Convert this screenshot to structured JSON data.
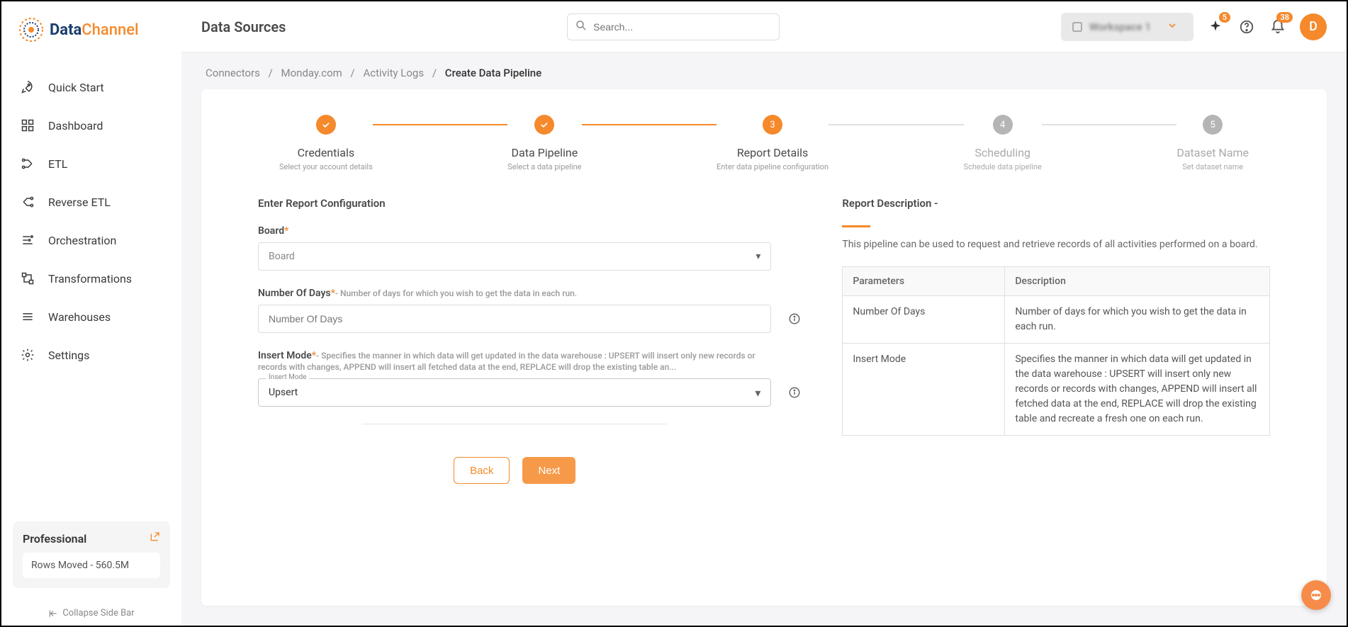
{
  "brand": {
    "part1": "Data",
    "part2": "Channel"
  },
  "header": {
    "title": "Data Sources",
    "search_placeholder": "Search...",
    "workspace": "Workspace 1",
    "sparkle_badge": "5",
    "bell_badge": "38",
    "avatar": "D"
  },
  "sidebar": {
    "items": [
      {
        "label": "Quick Start",
        "icon": "rocket"
      },
      {
        "label": "Dashboard",
        "icon": "grid"
      },
      {
        "label": "ETL",
        "icon": "etl"
      },
      {
        "label": "Reverse ETL",
        "icon": "reverse-etl"
      },
      {
        "label": "Orchestration",
        "icon": "orchestration"
      },
      {
        "label": "Transformations",
        "icon": "transform"
      },
      {
        "label": "Warehouses",
        "icon": "warehouse"
      },
      {
        "label": "Settings",
        "icon": "gear"
      }
    ],
    "plan_title": "Professional",
    "rows_moved": "Rows Moved - 560.5M",
    "collapse": "Collapse Side Bar"
  },
  "breadcrumb": {
    "items": [
      "Connectors",
      "Monday.com",
      "Activity Logs",
      "Create Data Pipeline"
    ]
  },
  "stepper": [
    {
      "title": "Credentials",
      "sub": "Select your account details",
      "state": "done"
    },
    {
      "title": "Data Pipeline",
      "sub": "Select a data pipeline",
      "state": "done"
    },
    {
      "title": "Report Details",
      "sub": "Enter data pipeline configuration",
      "state": "active",
      "num": "3"
    },
    {
      "title": "Scheduling",
      "sub": "Schedule data pipeline",
      "state": "pending",
      "num": "4"
    },
    {
      "title": "Dataset Name",
      "sub": "Set dataset name",
      "state": "pending",
      "num": "5"
    }
  ],
  "form": {
    "section_title": "Enter Report Configuration",
    "board_label": "Board",
    "board_placeholder": "Board",
    "days_label": "Number Of Days",
    "days_hint": "- Number of days for which you wish to get the data in each run.",
    "days_placeholder": "Number Of Days",
    "insert_label": "Insert Mode",
    "insert_hint": "- Specifies the manner in which data will get updated in the data warehouse : UPSERT will insert only new records or records with changes, APPEND will insert all fetched data at the end, REPLACE will drop the existing table an...",
    "insert_mat_label": "Insert Mode",
    "insert_value": "Upsert",
    "back": "Back",
    "next": "Next"
  },
  "description": {
    "title": "Report Description -",
    "text": "This pipeline can be used to request and retrieve records of all activities performed on a board.",
    "th_param": "Parameters",
    "th_desc": "Description",
    "rows": [
      {
        "p": "Number Of Days",
        "d": "Number of days for which you wish to get the data in each run."
      },
      {
        "p": "Insert Mode",
        "d": "Specifies the manner in which data will get updated in the data warehouse : UPSERT will insert only new records or records with changes, APPEND will insert all fetched data at the end, REPLACE will drop the existing table and recreate a fresh one on each run."
      }
    ]
  }
}
